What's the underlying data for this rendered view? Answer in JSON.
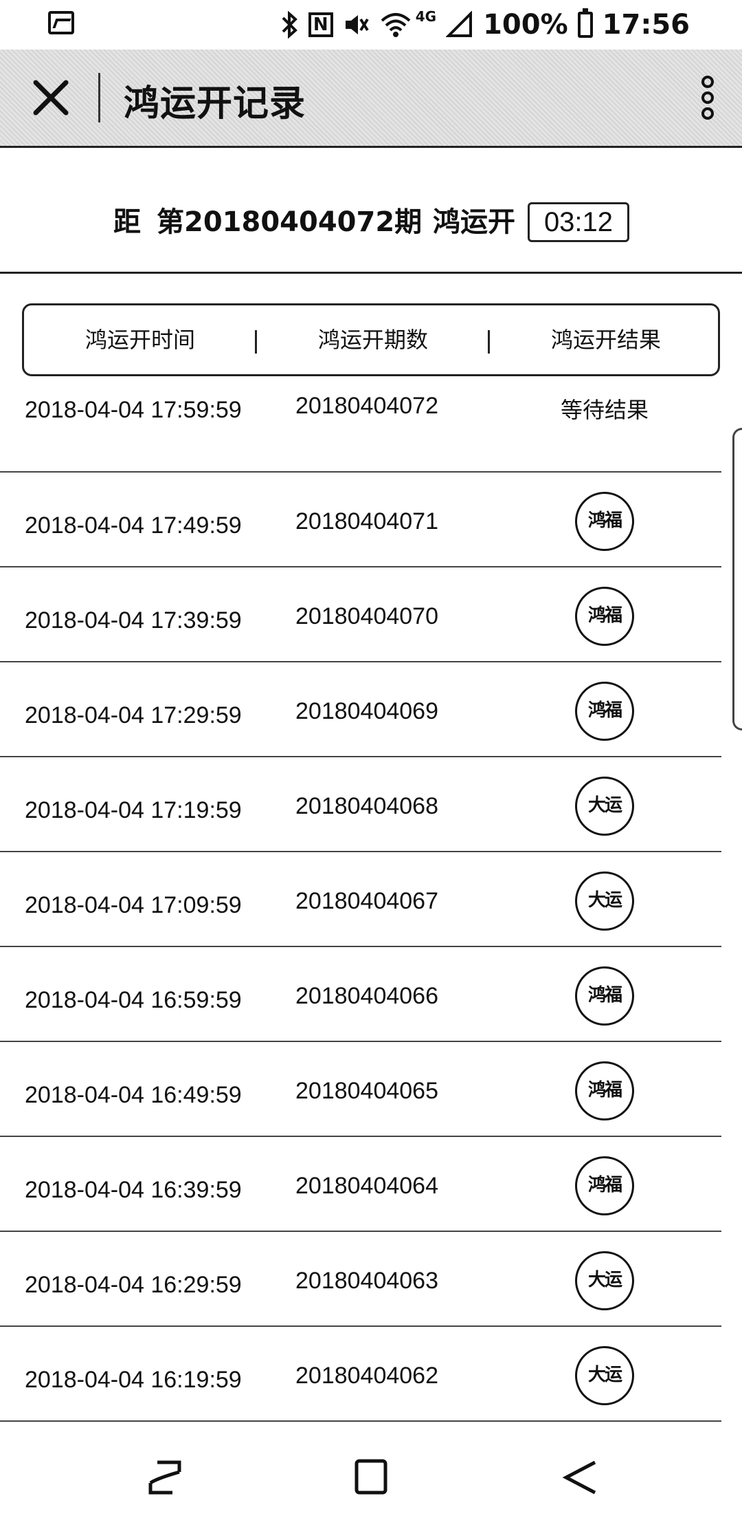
{
  "status_bar": {
    "battery": "100%",
    "time": "17:56",
    "network_label": "4G",
    "nfc_label": "N",
    "icons": [
      "gallery-icon",
      "bluetooth-icon",
      "nfc-icon",
      "mute-icon",
      "wifi-icon",
      "signal-icon",
      "battery-icon"
    ]
  },
  "app_bar": {
    "title": "鸿运开记录",
    "close_icon": "close-icon",
    "menu_icon": "more-vert-icon"
  },
  "countdown": {
    "distance_label": "距",
    "issue_label": "第20180404072期",
    "game_name": "鸿运开",
    "timer": "03:12"
  },
  "table": {
    "headers": [
      "鸿运开时间",
      "鸿运开期数",
      "鸿运开结果"
    ],
    "rows": [
      {
        "time": "2018-04-04 17:59:59",
        "issue": "20180404072",
        "result": "等待结果",
        "badge": false
      },
      {
        "time": "2018-04-04 17:49:59",
        "issue": "20180404071",
        "result": "鸿福",
        "badge": true
      },
      {
        "time": "2018-04-04 17:39:59",
        "issue": "20180404070",
        "result": "鸿福",
        "badge": true
      },
      {
        "time": "2018-04-04 17:29:59",
        "issue": "20180404069",
        "result": "鸿福",
        "badge": true
      },
      {
        "time": "2018-04-04 17:19:59",
        "issue": "20180404068",
        "result": "大运",
        "badge": true
      },
      {
        "time": "2018-04-04 17:09:59",
        "issue": "20180404067",
        "result": "大运",
        "badge": true
      },
      {
        "time": "2018-04-04 16:59:59",
        "issue": "20180404066",
        "result": "鸿福",
        "badge": true
      },
      {
        "time": "2018-04-04 16:49:59",
        "issue": "20180404065",
        "result": "鸿福",
        "badge": true
      },
      {
        "time": "2018-04-04 16:39:59",
        "issue": "20180404064",
        "result": "鸿福",
        "badge": true
      },
      {
        "time": "2018-04-04 16:29:59",
        "issue": "20180404063",
        "result": "大运",
        "badge": true
      },
      {
        "time": "2018-04-04 16:19:59",
        "issue": "20180404062",
        "result": "大运",
        "badge": true
      }
    ]
  },
  "nav_bar": {
    "icons": [
      "recents-icon",
      "home-icon",
      "back-icon"
    ]
  }
}
